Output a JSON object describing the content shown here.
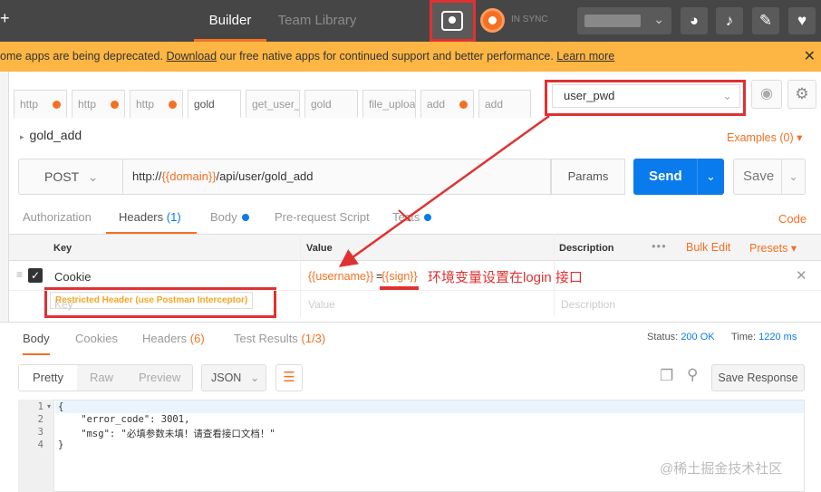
{
  "topbar": {
    "tabs": [
      "Builder",
      "Team Library"
    ],
    "sync_label": "IN SYNC"
  },
  "banner": {
    "text_before": "ome apps are being deprecated. ",
    "download": "Download",
    "text_middle": " our free native apps for continued support and better performance. ",
    "learn_more": "Learn more",
    "close": "✕"
  },
  "request_tabs": [
    {
      "label": "http",
      "dot": true
    },
    {
      "label": "http",
      "dot": true
    },
    {
      "label": "http",
      "dot": true
    },
    {
      "label": "gold",
      "dot": false
    },
    {
      "label": "get_user_i",
      "dot": false
    },
    {
      "label": "gold",
      "dot": false
    },
    {
      "label": "file_uploa",
      "dot": false
    },
    {
      "label": "add",
      "dot": true
    },
    {
      "label": "add",
      "dot": false
    }
  ],
  "environment": {
    "selected": "user_pwd"
  },
  "request": {
    "name": "gold_add",
    "examples": "Examples (0)",
    "method": "POST",
    "url_prefix": "http://",
    "url_var": "{{domain}}",
    "url_suffix": "/api/user/gold_add",
    "params": "Params",
    "send": "Send",
    "save": "Save"
  },
  "subtabs": [
    {
      "label": "Authorization",
      "badge": ""
    },
    {
      "label": "Headers",
      "badge": "(1)"
    },
    {
      "label": "Body",
      "badge": ""
    },
    {
      "label": "Pre-request Script",
      "badge": ""
    },
    {
      "label": "Tests",
      "badge": ""
    }
  ],
  "code_link": "Code",
  "headers_table": {
    "columns": [
      "Key",
      "Value",
      "Description"
    ],
    "dots": "•••",
    "bulk_edit": "Bulk Edit",
    "presets": "Presets",
    "row": {
      "key": "Cookie",
      "value_var1": "{{username}}",
      "value_eq": "=",
      "value_var2": "{{sign}}",
      "restricted": "Restricted Header (use Postman Interceptor)"
    },
    "placeholders": {
      "key": "Key",
      "value": "Value",
      "description": "Description"
    }
  },
  "annotation": "环境变量设置在login 接口",
  "response": {
    "tabs": [
      {
        "label": "Body",
        "badge": ""
      },
      {
        "label": "Cookies",
        "badge": ""
      },
      {
        "label": "Headers",
        "badge": "(6)"
      },
      {
        "label": "Test Results",
        "badge": "(1/3)"
      }
    ],
    "status_label": "Status:",
    "status_value": "200 OK",
    "time_label": "Time:",
    "time_value": "1220 ms",
    "view_modes": [
      "Pretty",
      "Raw",
      "Preview"
    ],
    "format": "JSON",
    "save_response": "Save Response",
    "line_numbers": [
      "1",
      "2",
      "3",
      "4"
    ],
    "body_lines": [
      "{",
      "    \"error_code\": 3001,",
      "    \"msg\": \"必填参数未填！请查看接口文档！\"",
      "}"
    ]
  },
  "watermark": "@稀土掘金技术社区",
  "colors": {
    "accent": "#f47023",
    "primary": "#097bed",
    "banner": "#fdb643",
    "annotation_red": "#e03131",
    "topbar": "#464646"
  }
}
